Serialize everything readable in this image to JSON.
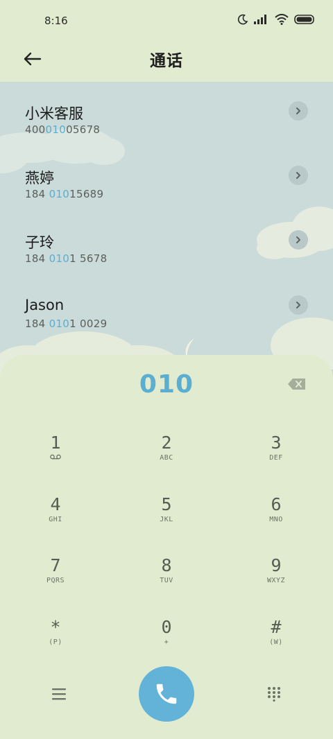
{
  "status_bar": {
    "time": "8:16",
    "icons": [
      "moon-icon",
      "signal-icon",
      "wifi-icon",
      "battery-icon"
    ]
  },
  "header": {
    "title": "通话",
    "back_icon": "arrow-left-icon"
  },
  "results": [
    {
      "name": "小米客服",
      "number_pre": "400",
      "number_match": "010",
      "number_post": "05678"
    },
    {
      "name": "燕婷",
      "number_pre": "184 ",
      "number_match": "010",
      "number_post": "15689"
    },
    {
      "name": "子玲",
      "number_pre": "184 ",
      "number_match": "010",
      "number_post": "1 5678"
    },
    {
      "name": "Jason",
      "number_pre": "184 ",
      "number_match": "010",
      "number_post": "1 0029"
    }
  ],
  "dialpad": {
    "digits": "010",
    "keys": [
      {
        "digit": "1",
        "letters": ""
      },
      {
        "digit": "2",
        "letters": "ABC"
      },
      {
        "digit": "3",
        "letters": "DEF"
      },
      {
        "digit": "4",
        "letters": "GHI"
      },
      {
        "digit": "5",
        "letters": "JKL"
      },
      {
        "digit": "6",
        "letters": "MNO"
      },
      {
        "digit": "7",
        "letters": "PQRS"
      },
      {
        "digit": "8",
        "letters": "TUV"
      },
      {
        "digit": "9",
        "letters": "WXYZ"
      },
      {
        "digit": "*",
        "letters": "(P)"
      },
      {
        "digit": "0",
        "letters": "+"
      },
      {
        "digit": "#",
        "letters": "(W)"
      }
    ]
  },
  "colors": {
    "background": "#e1ebcf",
    "sky": "#cbdbd9",
    "accent": "#5aaed0",
    "call_button": "#63b3d8",
    "digit_text": "#555d52"
  }
}
